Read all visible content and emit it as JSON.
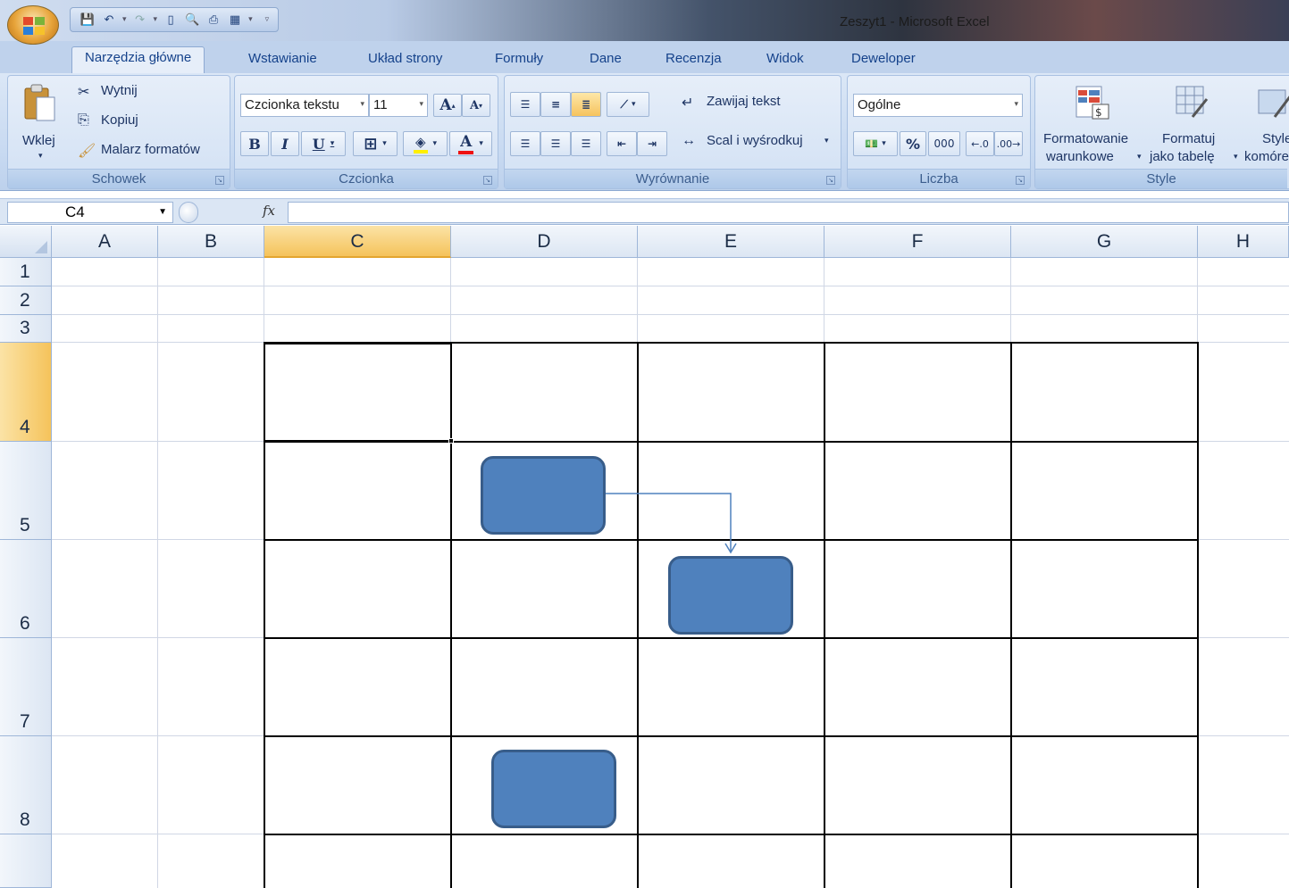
{
  "window": {
    "title": "Zeszyt1 - Microsoft Excel"
  },
  "tabs": [
    "Narzędzia główne",
    "Wstawianie",
    "Układ strony",
    "Formuły",
    "Dane",
    "Recenzja",
    "Widok",
    "Deweloper"
  ],
  "ribbon": {
    "clipboard": {
      "label": "Schowek",
      "paste": "Wklej",
      "cut": "Wytnij",
      "copy": "Kopiuj",
      "painter": "Malarz formatów"
    },
    "font": {
      "label": "Czcionka",
      "font_name": "Czcionka tekstu",
      "font_size": "11",
      "bold": "B",
      "italic": "I",
      "underline": "U",
      "grow": "A",
      "shrink": "A",
      "color": "A"
    },
    "alignment": {
      "label": "Wyrównanie",
      "wrap": "Zawijaj tekst",
      "merge": "Scal i wyśrodkuj"
    },
    "number": {
      "label": "Liczba",
      "format": "Ogólne",
      "percent": "%",
      "thousands": "000"
    },
    "styles": {
      "label": "Style",
      "conditional_1": "Formatowanie",
      "conditional_2": "warunkowe",
      "table_1": "Formatuj",
      "table_2": "jako tabelę",
      "cell_1": "Style",
      "cell_2": "komórek"
    }
  },
  "formula_bar": {
    "name_box": "C4",
    "fx": "fx",
    "value": ""
  },
  "columns": [
    "A",
    "B",
    "C",
    "D",
    "E",
    "F",
    "G",
    "H"
  ],
  "rows": [
    "1",
    "2",
    "3",
    "4",
    "5",
    "6",
    "7",
    "8"
  ],
  "selection": {
    "cell": "C4",
    "column": "C",
    "row": "4"
  },
  "colors": {
    "shape_fill": "#4f81bd",
    "shape_border": "#385d8a",
    "connector": "#4f81bd",
    "selected_header": "#f5c35b"
  }
}
